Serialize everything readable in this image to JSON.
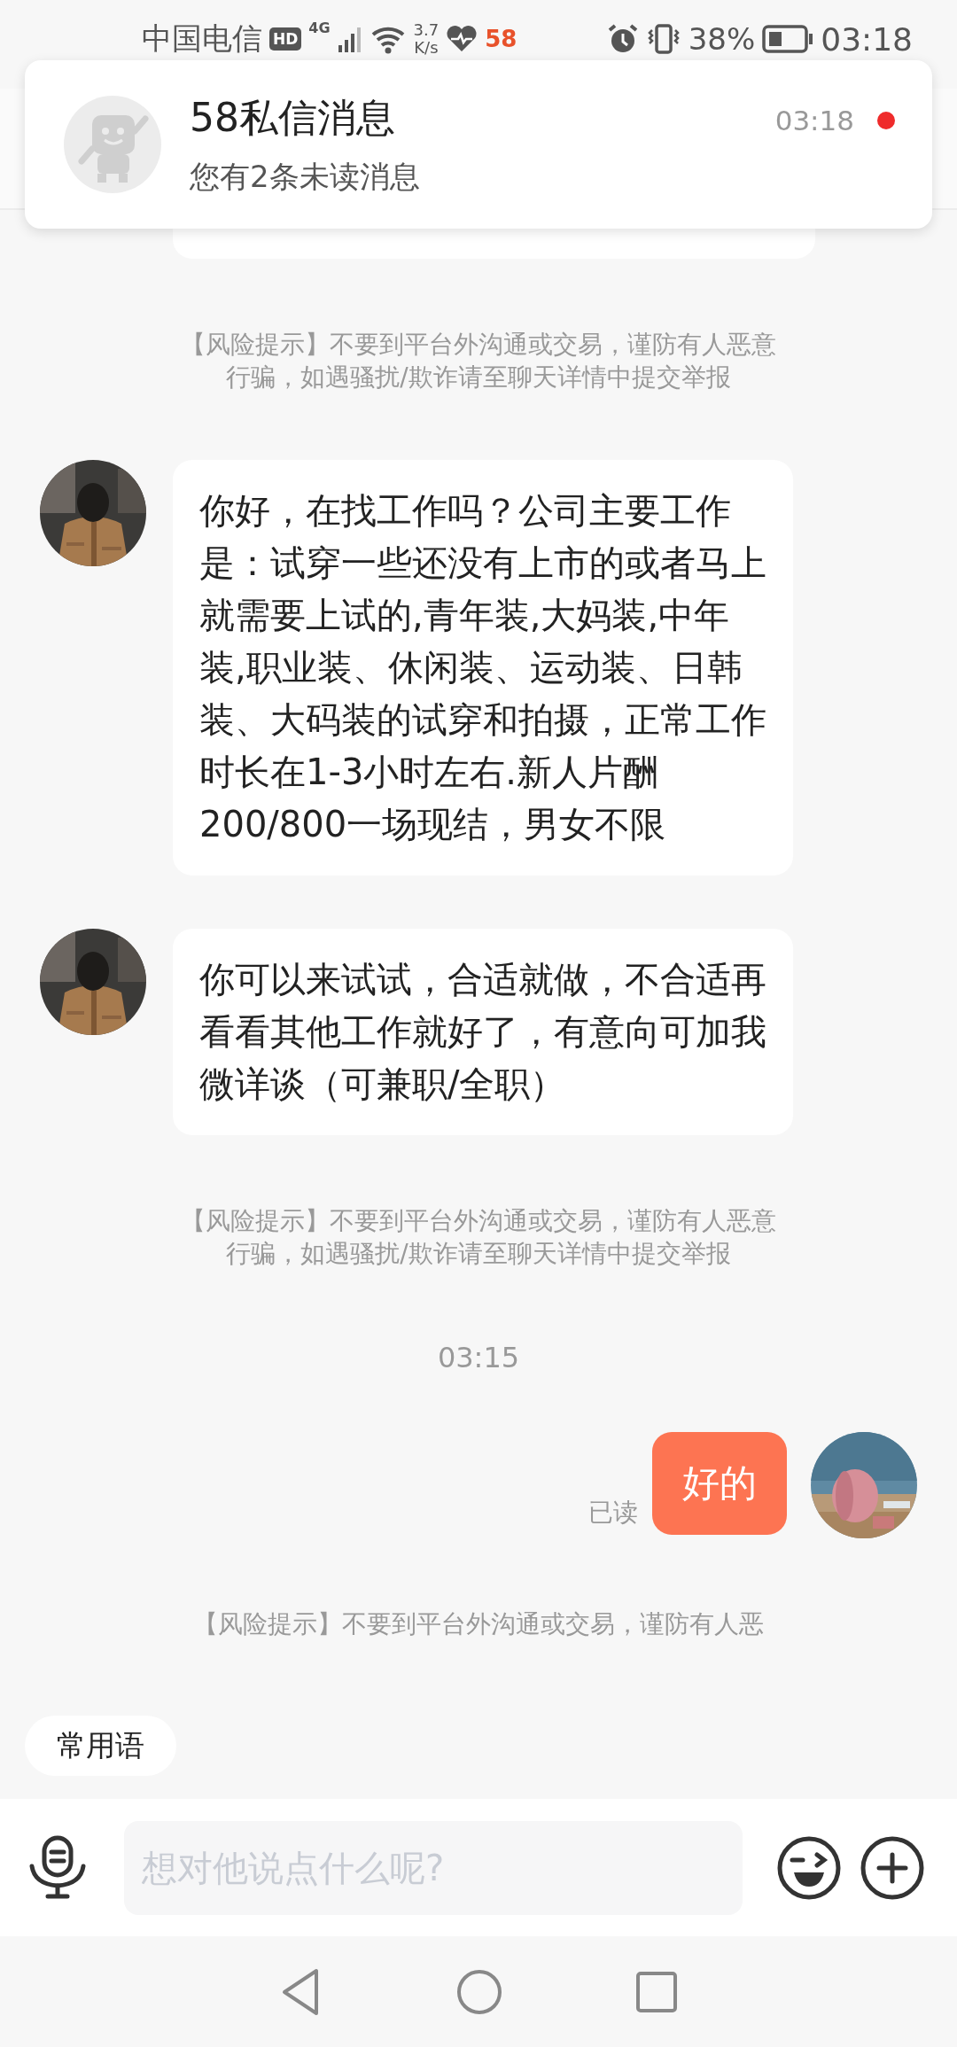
{
  "status_bar": {
    "carrier": "中国电信",
    "hd_badge": "HD",
    "network": "4G",
    "speed_value": "3.7",
    "speed_unit": "K/s",
    "app_badge": "58",
    "battery_percent": "38%",
    "time": "03:18"
  },
  "notification": {
    "title": "58私信消息",
    "body": "您有2条未读消息",
    "time": "03:18",
    "unread": true
  },
  "messages": [
    {
      "kind": "cut_bubble"
    },
    {
      "kind": "tip",
      "text": "【风险提示】不要到平台外沟通或交易，谨防有人恶意行骗，如遇骚扰/欺诈请至聊天详情中提交举报"
    },
    {
      "kind": "incoming",
      "text": "你好，在找工作吗？公司主要工作是：试穿一些还没有上市的或者马上就需要上试的,青年装,大妈装,中年装,职业装、休闲装、运动装、日韩装、大码装的试穿和拍摄，正常工作时长在1-3小时左右.新人片酬200/800一场现结，男女不限"
    },
    {
      "kind": "incoming",
      "text": "你可以来试试，合适就做，不合适再看看其他工作就好了，有意向可加我微详谈（可兼职/全职）"
    },
    {
      "kind": "tip",
      "text": "【风险提示】不要到平台外沟通或交易，谨防有人恶意行骗，如遇骚扰/欺诈请至聊天详情中提交举报"
    },
    {
      "kind": "time",
      "text": "03:15"
    },
    {
      "kind": "outgoing",
      "text": "好的",
      "read_receipt": "已读"
    },
    {
      "kind": "tip",
      "text": "【风险提示】不要到平台外沟通或交易，谨防有人恶"
    }
  ],
  "quick_reply": {
    "label": "常用语"
  },
  "composer": {
    "placeholder": "想对他说点什么呢?"
  }
}
